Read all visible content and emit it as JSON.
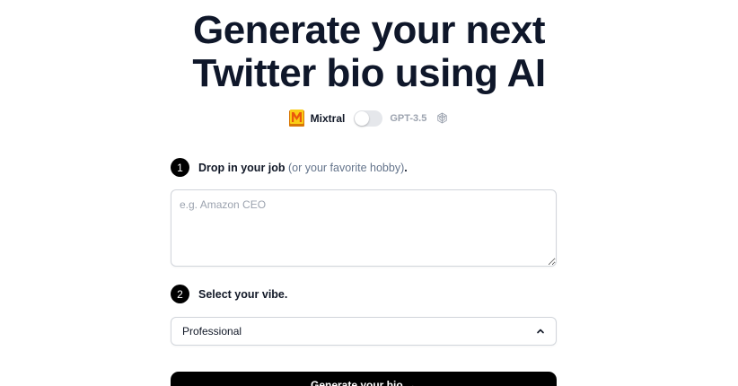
{
  "header": {
    "title_line1": "Generate your next",
    "title_line2": "Twitter bio using AI"
  },
  "model_toggle": {
    "left_model": "Mixtral",
    "right_model": "GPT-3.5",
    "left_icon": "mixtral-logo-icon",
    "right_icon": "openai-icon",
    "selected": "Mixtral"
  },
  "step1": {
    "number": "1",
    "label": "Drop in your job",
    "hint": "(or your favorite hobby)",
    "suffix": ".",
    "textarea_placeholder": "e.g. Amazon CEO",
    "textarea_value": ""
  },
  "step2": {
    "number": "2",
    "label": "Select your vibe.",
    "select_value": "Professional",
    "select_icon": "chevron-up-icon"
  },
  "generate": {
    "label": "Generate your bio →"
  },
  "colors": {
    "text": "#0f172a",
    "muted": "#64748b",
    "button_bg": "#000000",
    "toggle_off": "#e5e7eb",
    "mixtral_orange": "#f7a21b"
  }
}
